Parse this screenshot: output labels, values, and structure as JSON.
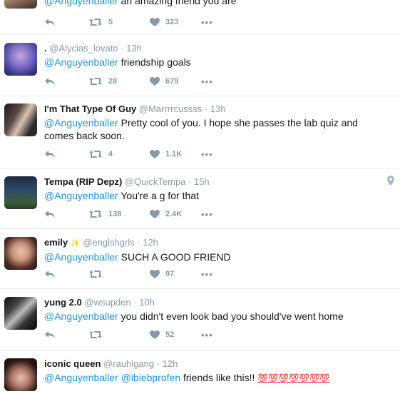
{
  "tweets": [
    {
      "id": "t0",
      "name": "",
      "handle": "",
      "time": "",
      "mention": "@Anguyenballer",
      "text": " an amazing friend you are",
      "retweets": "5",
      "likes": "323",
      "more": "•••"
    },
    {
      "id": "t1",
      "name": ".",
      "handle": "@Alycias_lovato",
      "time": "· 13h",
      "mention": "@Anguyenballer",
      "text": " friendship goals",
      "retweets": "28",
      "likes": "679",
      "more": "•••"
    },
    {
      "id": "t2",
      "name": "I'm That Type Of Guy",
      "handle": "@Marrrrcussss",
      "time": "· 13h",
      "mention": "@Anguyenballer",
      "text": " Pretty cool of you. I hope she passes the lab quiz and comes back soon.",
      "retweets": "4",
      "likes": "1.1K",
      "more": "•••"
    },
    {
      "id": "t3",
      "name": "Tempa (RIP Depz)",
      "handle": "@QuickTempa",
      "time": "· 15h",
      "mention": "@Anguyenballer",
      "text": " You're a g for that",
      "retweets": "138",
      "likes": "2.4K",
      "more": "•••"
    },
    {
      "id": "t4",
      "name": "emily",
      "badge": "✨",
      "handle": "@englshgrls",
      "time": "· 12h",
      "mention": "@Anguyenballer",
      "text": " SUCH A GOOD FRIEND",
      "retweets": "",
      "likes": "97",
      "more": "•••"
    },
    {
      "id": "t5",
      "name": "yung 2.0",
      "handle": "@wsupden",
      "time": "· 10h",
      "mention": "@Anguyenballer",
      "text": " you didn't even look bad you should've went home",
      "retweets": "",
      "likes": "52",
      "more": "•••"
    },
    {
      "id": "t6",
      "name": "iconic queen",
      "handle": "@rauhlgang",
      "time": "· 12h",
      "mention": "@Anguyenballer @ibiebprofen",
      "text": " friends like this!! ",
      "emoji": "💯💯💯💯💯💯💯",
      "retweets": "",
      "likes": "",
      "more": ""
    }
  ],
  "colors": {
    "link": "#1b95e0",
    "muted": "#8899a6",
    "divider": "#e6ecf0"
  },
  "icons": {
    "reply": "reply-icon",
    "retweet": "retweet-icon",
    "like": "heart-icon",
    "more": "more-icon",
    "location": "location-pin-icon"
  }
}
